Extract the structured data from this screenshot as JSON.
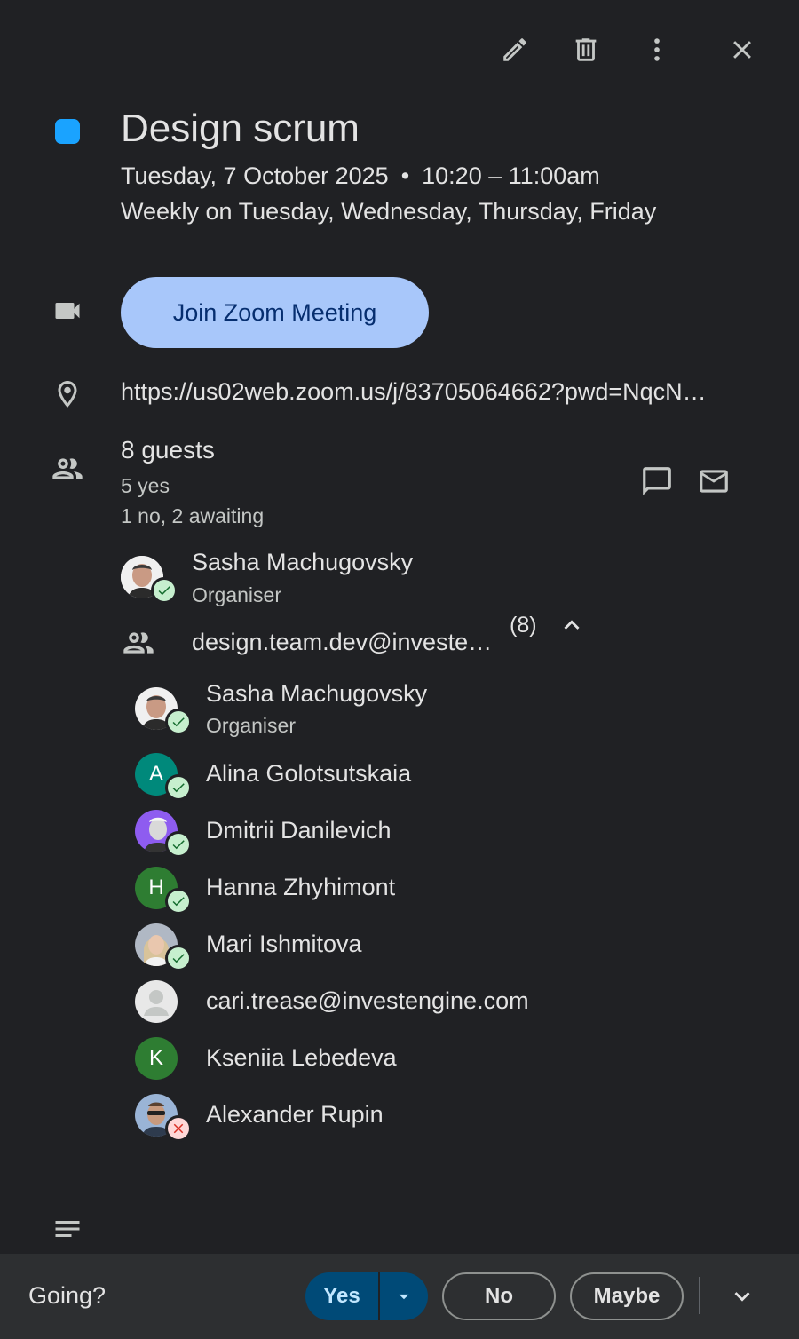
{
  "event": {
    "color": "#1aa3ff",
    "title": "Design scrum",
    "date": "Tuesday, 7 October 2025",
    "separator": "•",
    "time": "10:20 – 11:00am",
    "recurrence": "Weekly on Tuesday, Wednesday, Thursday, Friday"
  },
  "conference": {
    "join_label": "Join Zoom Meeting"
  },
  "location": {
    "url": "https://us02web.zoom.us/j/83705064662?pwd=NqcN…"
  },
  "guests": {
    "count_label": "8 guests",
    "yes_label": "5 yes",
    "other_label": "1 no, 2 awaiting",
    "organiser": {
      "name": "Sasha Machugovsky",
      "role": "Organiser"
    },
    "group": {
      "email": "design.team.dev@investe…",
      "count": "(8)"
    },
    "members": [
      {
        "name": "Sasha Machugovsky",
        "role": "Organiser",
        "initial": "",
        "status": "yes"
      },
      {
        "name": "Alina Golotsutskaia",
        "initial": "A",
        "status": "yes",
        "color": "#00897b"
      },
      {
        "name": "Dmitrii Danilevich",
        "initial": "",
        "status": "yes",
        "color": "#8e5cf0"
      },
      {
        "name": "Hanna Zhyhimont",
        "initial": "H",
        "status": "yes",
        "color": "#2e7d32"
      },
      {
        "name": "Mari Ishmitova",
        "initial": "",
        "status": "yes"
      },
      {
        "name": "cari.trease@investengine.com",
        "initial": "",
        "status": "awaiting"
      },
      {
        "name": "Kseniia Lebedeva",
        "initial": "K",
        "status": "awaiting",
        "color": "#2e7d32"
      },
      {
        "name": "Alexander Rupin",
        "initial": "",
        "status": "no"
      }
    ]
  },
  "rsvp": {
    "prompt": "Going?",
    "yes": "Yes",
    "no": "No",
    "maybe": "Maybe"
  },
  "icons": [
    "edit-icon",
    "delete-icon",
    "more-vert-icon",
    "close-icon",
    "video-icon",
    "location-icon",
    "people-icon",
    "chat-icon",
    "mail-icon",
    "chevron-up-icon",
    "notes-icon",
    "dropdown-icon",
    "chevron-down-icon"
  ]
}
